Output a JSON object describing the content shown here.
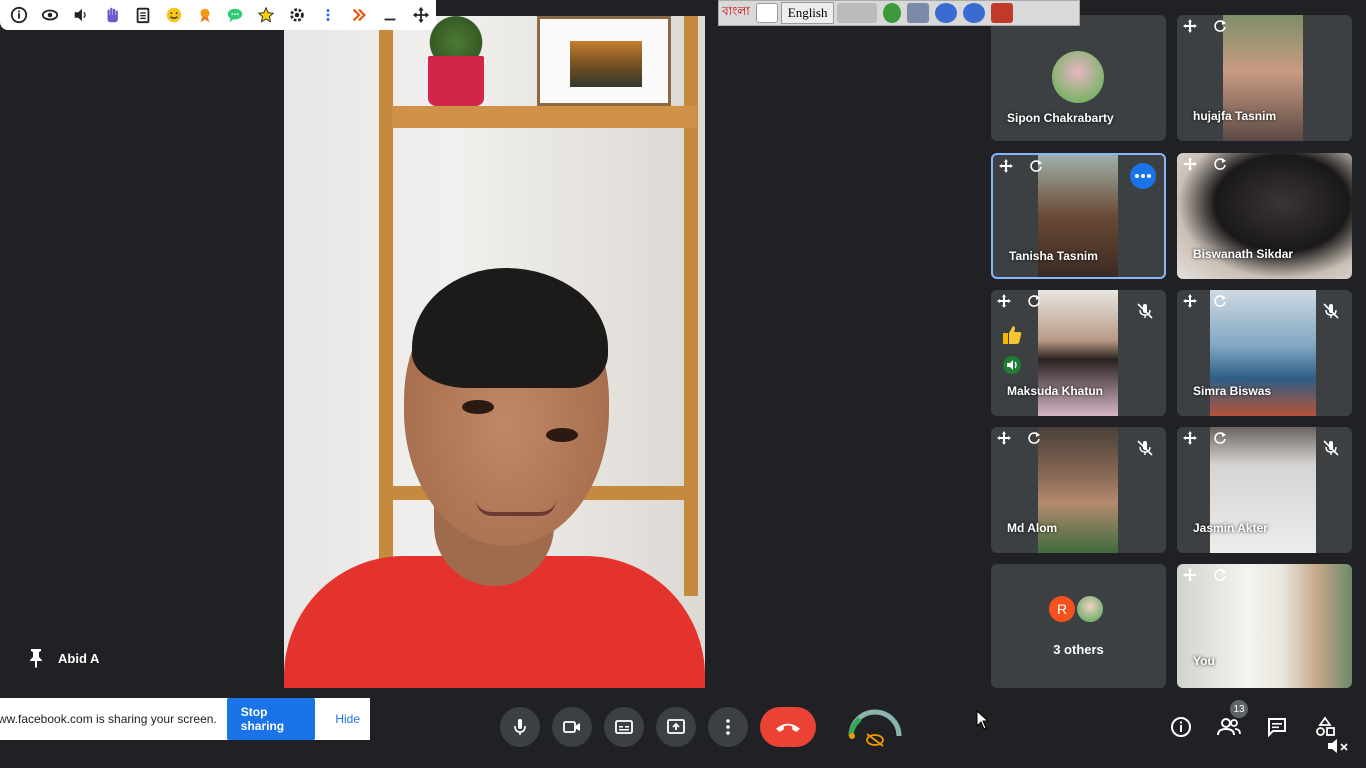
{
  "spotlight": {
    "pinned_name": "Abid A"
  },
  "lang_bar": {
    "script_label": "বাংলা",
    "language": "English"
  },
  "tiles": [
    {
      "name": "Sipon Chakrabarty"
    },
    {
      "name": "hujajfa Tasnim"
    },
    {
      "name": "Tanisha Tasnim"
    },
    {
      "name": "Biswanath Sikdar"
    },
    {
      "name": "Maksuda Khatun"
    },
    {
      "name": "Simra Biswas"
    },
    {
      "name": "Md Alom"
    },
    {
      "name": "Jasmin Akter"
    },
    {
      "name": "3 others",
      "avatar_letter": "R"
    },
    {
      "name": "You"
    }
  ],
  "share_banner": {
    "message": "ww.facebook.com is sharing your screen.",
    "stop_label": "Stop sharing",
    "hide_label": "Hide"
  },
  "people_count": "13",
  "colors": {
    "background": "#202124",
    "tile": "#3c4043",
    "accent_blue": "#1a73e8",
    "end_call_red": "#ea4335"
  }
}
